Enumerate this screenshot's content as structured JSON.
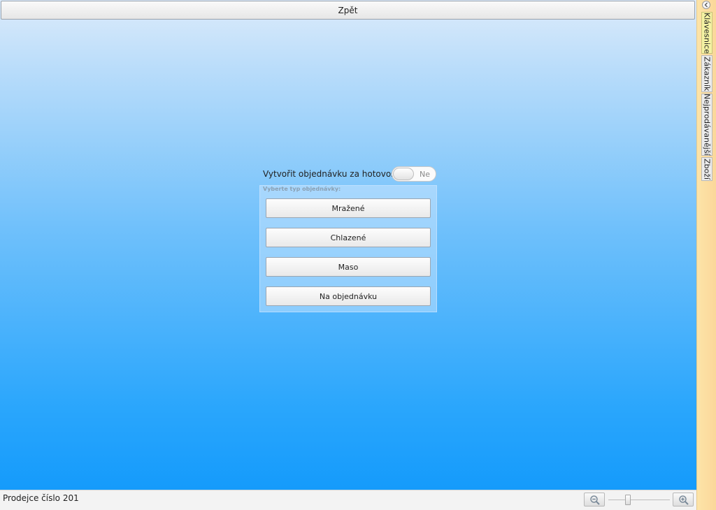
{
  "header": {
    "back_label": "Zpět"
  },
  "dialog": {
    "cash_question": "Vytvořit objednávku za hotovost?",
    "cash_toggle_value": "Ne",
    "type_caption": "Vyberte typ objednávky:",
    "order_types": [
      {
        "label": "Mražené"
      },
      {
        "label": "Chlazené"
      },
      {
        "label": "Maso"
      },
      {
        "label": "Na objednávku"
      }
    ]
  },
  "status_bar": {
    "seller": "Prodejce číslo 201",
    "zoom_level": 0.3
  },
  "side_tabs": [
    {
      "label": "Klávesnice",
      "active": true
    },
    {
      "label": "Zákazník",
      "active": false
    },
    {
      "label": "Nejprodávanější",
      "active": false
    },
    {
      "label": "Zboží",
      "active": false
    }
  ],
  "icons": {
    "collapse": "chevron-left-icon",
    "zoom_out": "zoom-out-icon",
    "zoom_in": "zoom-in-icon"
  },
  "colors": {
    "side_panel": "#fde4a8",
    "active_tab": "#f4f2a3",
    "background_top": "#dcebfb",
    "background_bottom": "#0f98fb"
  }
}
